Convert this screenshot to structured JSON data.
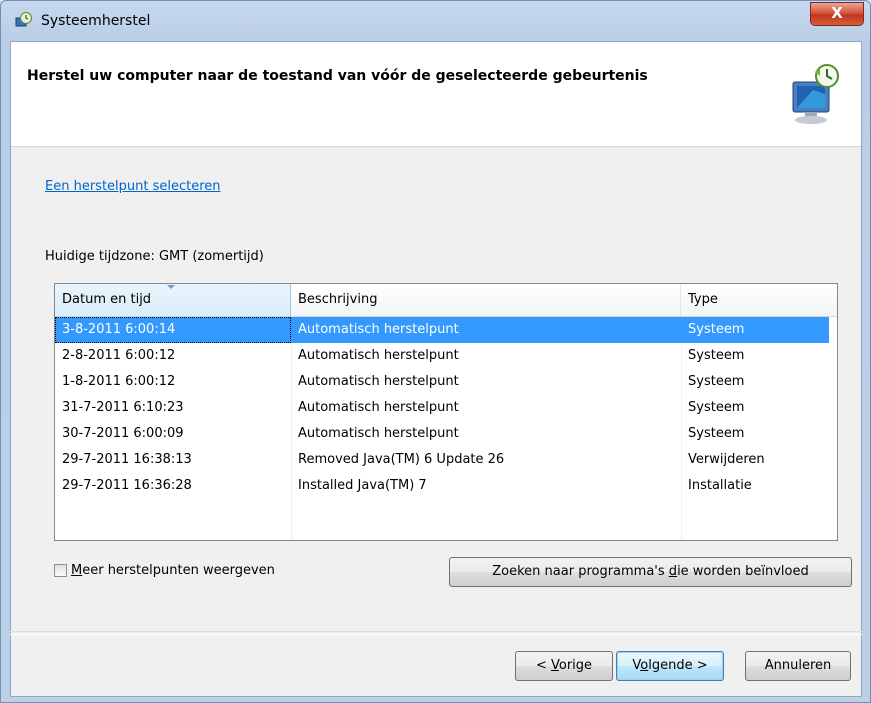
{
  "window": {
    "title": "Systeemherstel",
    "close_glyph": "X",
    "icon": "system-restore-icon"
  },
  "header": {
    "title": "Herstel uw computer naar de toestand van vóór de geselecteerde gebeurtenis",
    "icon": "computer-restore-icon"
  },
  "link": {
    "label": "Een herstelpunt selecteren"
  },
  "timezone": {
    "label": "Huidige tijdzone: GMT (zomertijd)"
  },
  "table": {
    "columns": [
      "Datum en tijd",
      "Beschrijving",
      "Type"
    ],
    "sorted_column": "Datum en tijd",
    "selected_row": 0,
    "rows": [
      {
        "date": "3-8-2011 6:00:14",
        "description": "Automatisch herstelpunt",
        "type": "Systeem"
      },
      {
        "date": "2-8-2011 6:00:12",
        "description": "Automatisch herstelpunt",
        "type": "Systeem"
      },
      {
        "date": "1-8-2011 6:00:12",
        "description": "Automatisch herstelpunt",
        "type": "Systeem"
      },
      {
        "date": "31-7-2011 6:10:23",
        "description": "Automatisch herstelpunt",
        "type": "Systeem"
      },
      {
        "date": "30-7-2011 6:00:09",
        "description": "Automatisch herstelpunt",
        "type": "Systeem"
      },
      {
        "date": "29-7-2011 16:38:13",
        "description": "Removed Java(TM) 6 Update 26",
        "type": "Verwijderen"
      },
      {
        "date": "29-7-2011 16:36:28",
        "description": "Installed Java(TM) 7",
        "type": "Installatie"
      }
    ]
  },
  "checkbox": {
    "label_prefix": "M",
    "label_rest": "eer herstelpunten weergeven",
    "checked": false
  },
  "buttons": {
    "search_pre": "Zoeken naar programma's ",
    "search_u": "d",
    "search_post": "ie worden beïnvloed",
    "prev_pre": "< ",
    "prev_u": "V",
    "prev_post": "orige",
    "next_pre": "V",
    "next_u": "o",
    "next_post": "lgende >",
    "cancel": "Annuleren"
  },
  "colors": {
    "selection": "#3399ff",
    "link": "#0066cc",
    "close_button": "#c2371d"
  }
}
